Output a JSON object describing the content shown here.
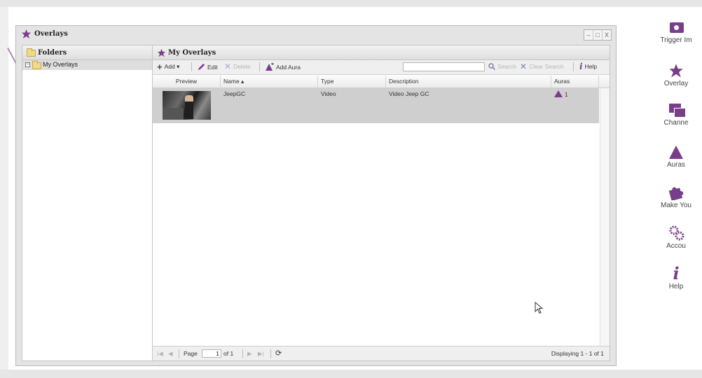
{
  "window": {
    "title": "Overlays",
    "controls": [
      "–",
      "□",
      "X"
    ]
  },
  "folders_panel": {
    "title": "Folders",
    "tree": [
      {
        "toggle": "−",
        "label": "My Overlays"
      }
    ]
  },
  "overlays_panel": {
    "title": "My Overlays",
    "toolbar": {
      "add": "Add ▾",
      "edit": "Edit",
      "delete": "Delete",
      "add_aura": "Add Aura",
      "search_value": "",
      "search": "Search",
      "clear_search": "Clear Search",
      "help": "Help"
    },
    "columns": [
      "Preview",
      "Name ▴",
      "Type",
      "Description",
      "Auras"
    ],
    "rows": [
      {
        "name": "JeepGC",
        "type": "Video",
        "description": "Video Jeep GC",
        "auras": "1"
      }
    ],
    "pager": {
      "first": "|◀",
      "prev": "◀",
      "page_label": "Page",
      "page_value": "1",
      "of": "of 1",
      "next": "▶",
      "last": "▶|",
      "refresh": "⟳",
      "displaying": "Displaying 1 - 1 of 1"
    }
  },
  "sidebar": {
    "items": [
      {
        "label": "Trigger Im",
        "icon": "camera-icon"
      },
      {
        "label": "Overlay",
        "icon": "overlay-star-icon"
      },
      {
        "label": "Channe",
        "icon": "channels-icon"
      },
      {
        "label": "Auras",
        "icon": "aura-triangle-icon"
      },
      {
        "label": "Make You",
        "icon": "puzzle-icon"
      },
      {
        "label": "Accou",
        "icon": "gears-icon"
      },
      {
        "label": "Help",
        "icon": "info-icon"
      }
    ]
  },
  "colors": {
    "brand_purple": "#7a3d8a",
    "selected_row": "#cfcfcf",
    "window_bg": "#e4e4e4"
  }
}
